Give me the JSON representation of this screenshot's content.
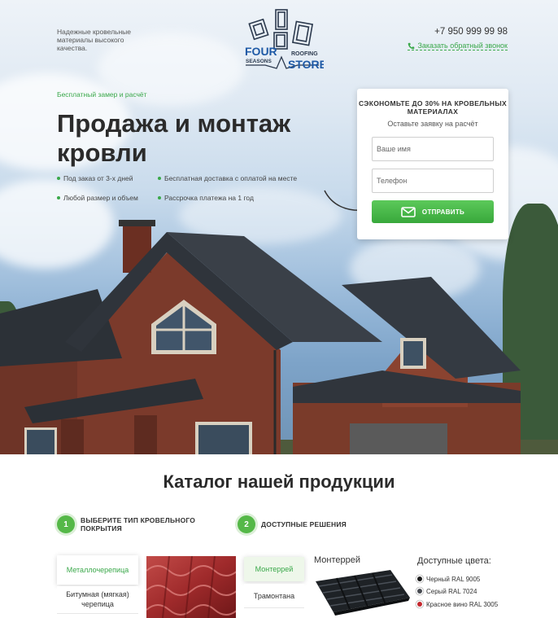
{
  "header": {
    "tagline": "Надежные кровельные материалы высокого качества.",
    "logo": {
      "word_top": "FOUR",
      "word_bottom": "SEASONS",
      "word_right": "ROOFING",
      "word_store": "STORE"
    },
    "phone": "+7 950 999 99 98",
    "callback_label": "Заказать обратный звонок"
  },
  "hero": {
    "promo": "Бесплатный замер и расчёт",
    "title": "Продажа и монтаж кровли",
    "features": [
      "Под заказ от 3-х дней",
      "Бесплатная доставка с оплатой на месте",
      "Любой размер и объем",
      "Рассрочка платежа на 1 год"
    ]
  },
  "form": {
    "heading": "СЭКОНОМЬТЕ ДО 30% НА КРОВЕЛЬНЫХ МАТЕРИАЛАХ",
    "subheading": "Оставьте заявку на расчёт",
    "name_placeholder": "Ваше имя",
    "phone_placeholder": "Телефон",
    "submit_label": "ОТПРАВИТЬ"
  },
  "catalog": {
    "title": "Каталог нашей продукции",
    "steps": [
      {
        "num": "1",
        "label": "ВЫБЕРИТЕ ТИП КРОВЕЛЬНОГО ПОКРЫТИЯ"
      },
      {
        "num": "2",
        "label": "ДОСТУПНЫЕ РЕШЕНИЯ"
      }
    ],
    "roof_types": [
      "Металлочерепица",
      "Битумная (мягкая) черепица"
    ],
    "solutions": [
      "Монтеррей",
      "Трамонтана"
    ],
    "product_name": "Монтеррей",
    "colors_title": "Доступные цвета:",
    "colors": [
      {
        "name": "Черный RAL 9005",
        "hex": "#1a1a1a"
      },
      {
        "name": "Серый RAL 7024",
        "hex": "#474a51"
      },
      {
        "name": "Красное вино RAL 3005",
        "hex": "#c4282e"
      }
    ]
  },
  "colors": {
    "accent": "#3aa84a",
    "button": "#45b340",
    "text": "#2b2b2b"
  }
}
